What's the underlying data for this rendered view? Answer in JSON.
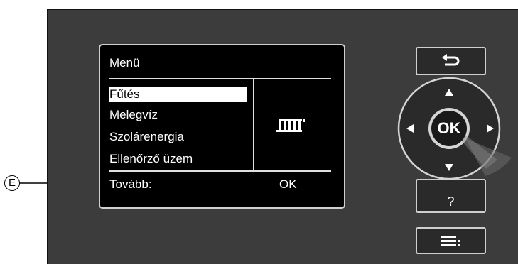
{
  "callout": {
    "label": "E"
  },
  "screen": {
    "title": "Menü",
    "items": [
      {
        "label": "Fűtés",
        "selected": true
      },
      {
        "label": "Melegvíz",
        "selected": false
      },
      {
        "label": "Szolárenergia",
        "selected": false
      },
      {
        "label": "Ellenőrző üzem",
        "selected": false
      }
    ],
    "footer_label": "Tovább:",
    "footer_value": "OK",
    "icon": "radiator-icon"
  },
  "keypad": {
    "back_icon": "back-arrow-icon",
    "ok_label": "OK",
    "up_icon": "arrow-up-icon",
    "down_icon": "arrow-down-icon",
    "left_icon": "arrow-left-icon",
    "right_icon": "arrow-right-icon",
    "help_label": "?",
    "menu_icon": "menu-list-icon"
  },
  "colors": {
    "panel": "#3c3c3c",
    "screen": "#000000",
    "text": "#ffffff",
    "selected_bg": "#ffffff"
  }
}
